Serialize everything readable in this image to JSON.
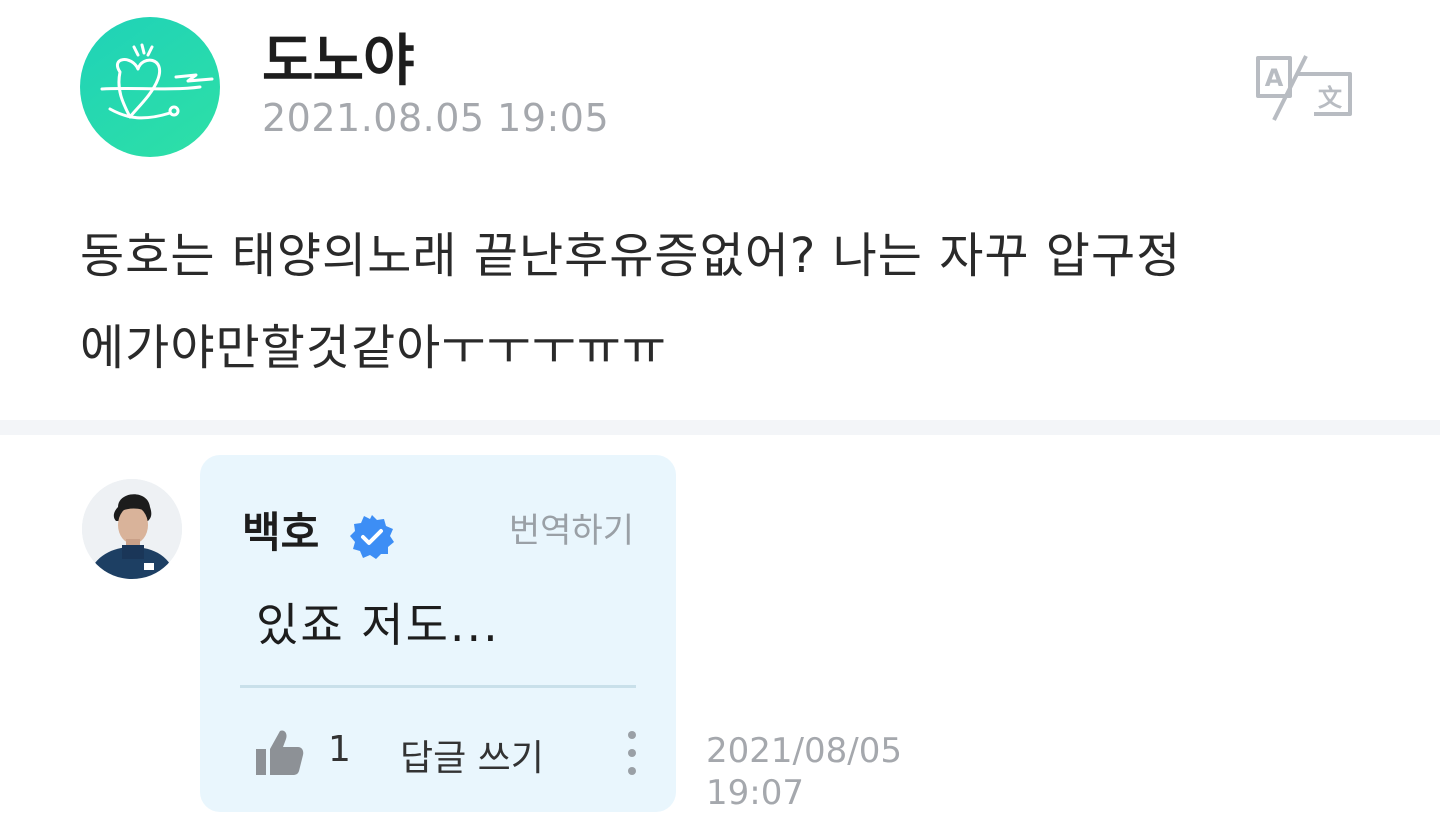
{
  "post": {
    "author": "도노야",
    "date": "2021.08.05 19:05",
    "body_line1": "동호는 태양의노래 끝난후유증없어? 나는 자꾸 압구정",
    "body_line2": "에가야만할것같아ㅜㅜㅜㅠㅠ"
  },
  "reply": {
    "author": "백호",
    "translate_label": "번역하기",
    "text": "있죠 저도...",
    "like_count": "1",
    "write_reply_label": "답글 쓰기",
    "date_line1": "2021/08/05",
    "date_line2": "19:07"
  },
  "icons": {
    "translate": "translate-icon",
    "verified": "verified-badge-icon",
    "like": "thumbs-up-icon",
    "more": "more-vertical-icon"
  },
  "colors": {
    "avatar_gradient_start": "#1fd2b8",
    "avatar_gradient_end": "#2ee0a6",
    "reply_bubble_bg": "#e9f6fd",
    "verified_blue": "#3d8ef5",
    "muted_text": "#a5a8ad"
  }
}
